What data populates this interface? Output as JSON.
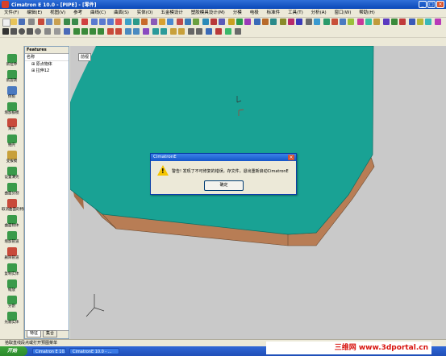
{
  "window": {
    "title": "Cimatron E 10.0 - [PIPE] - [零件]"
  },
  "menu": [
    "文件(F)",
    "编辑(E)",
    "视图(V)",
    "参考",
    "曲线(C)",
    "曲面(S)",
    "实体(O)",
    "五金模设计",
    "塑胶模具设计(M)",
    "分模",
    "电极",
    "标准件",
    "工具(T)",
    "分析(A)",
    "窗口(W)",
    "帮助(H)"
  ],
  "viewport": {
    "view_label": "前视"
  },
  "features_panel": {
    "title": "Features",
    "column_header": "名称",
    "tree": [
      "原点物体",
      "拉伸12"
    ],
    "tabs": [
      "特征",
      "集合"
    ]
  },
  "leftbar": [
    "新拉伸",
    "新旋转",
    "倒角",
    "增加拔模",
    "薄壳",
    "抽壳",
    "变拔模",
    "设置薄壳",
    "曲面分割",
    "取消曲面的特征",
    "曲面物体",
    "增加管道",
    "删除管道",
    "复制实体",
    "缩放",
    "分割",
    "光顺实体"
  ],
  "dialog": {
    "title": "CimatronE",
    "message": "警告! 发现了不可修复的错误，存文件，退出重新启动CimatronE",
    "ok_label": "确定",
    "warn_glyph": "!"
  },
  "statusbar": {
    "text": "拾取直线段点或打开预图菜单"
  },
  "taskbar": {
    "start_label": "开始",
    "items": [
      "Cimatron E 10.0 - [...]",
      "CimatronE 10.0 - ..."
    ]
  },
  "watermark": {
    "text": "三维网 www.3dportal.cn"
  }
}
